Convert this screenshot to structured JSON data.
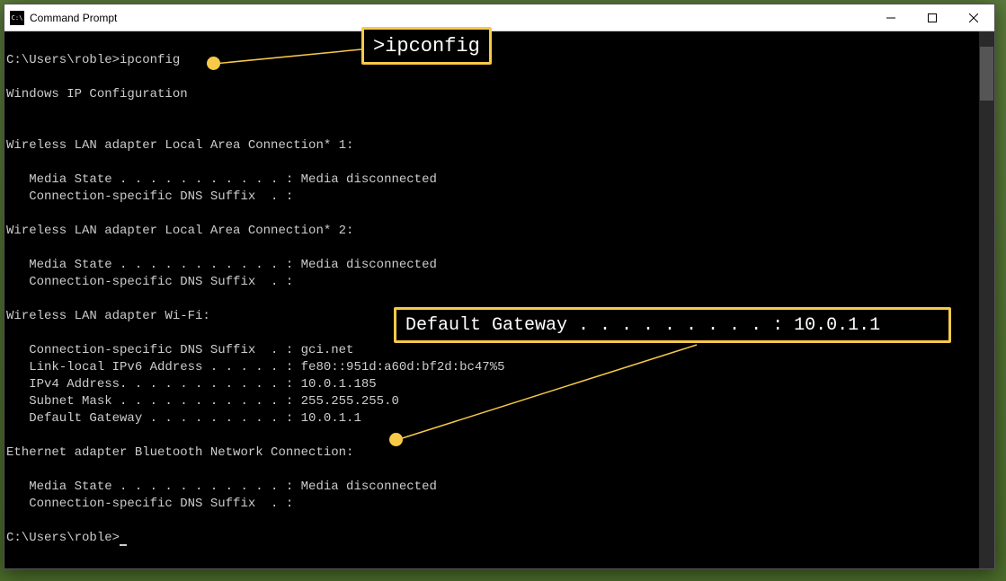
{
  "window": {
    "title": "Command Prompt"
  },
  "terminal": {
    "prompt1": "C:\\Users\\roble>",
    "command": "ipconfig",
    "header": "Windows IP Configuration",
    "sections": [
      {
        "title": "Wireless LAN adapter Local Area Connection* 1:",
        "lines": [
          "   Media State . . . . . . . . . . . : Media disconnected",
          "   Connection-specific DNS Suffix  . :"
        ]
      },
      {
        "title": "Wireless LAN adapter Local Area Connection* 2:",
        "lines": [
          "   Media State . . . . . . . . . . . : Media disconnected",
          "   Connection-specific DNS Suffix  . :"
        ]
      },
      {
        "title": "Wireless LAN adapter Wi-Fi:",
        "lines": [
          "   Connection-specific DNS Suffix  . : gci.net",
          "   Link-local IPv6 Address . . . . . : fe80::951d:a60d:bf2d:bc47%5",
          "   IPv4 Address. . . . . . . . . . . : 10.0.1.185",
          "   Subnet Mask . . . . . . . . . . . : 255.255.255.0",
          "   Default Gateway . . . . . . . . . : 10.0.1.1"
        ]
      },
      {
        "title": "Ethernet adapter Bluetooth Network Connection:",
        "lines": [
          "   Media State . . . . . . . . . . . : Media disconnected",
          "   Connection-specific DNS Suffix  . :"
        ]
      }
    ],
    "prompt2": "C:\\Users\\roble>"
  },
  "annotations": {
    "callout1": ">ipconfig",
    "callout2": "Default Gateway . . . . . . . . . : 10.0.1.1"
  }
}
